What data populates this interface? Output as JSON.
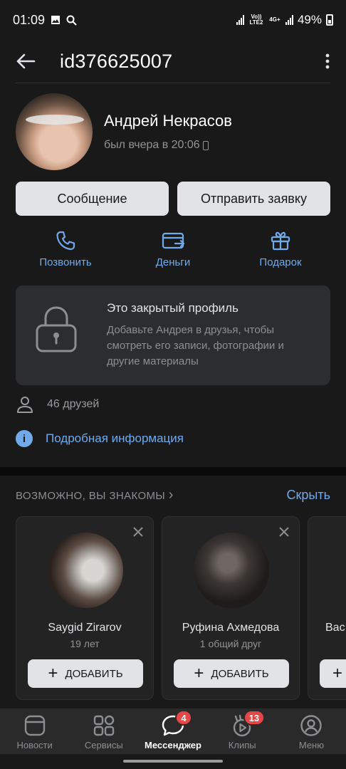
{
  "status_bar": {
    "time": "01:09",
    "network_label": "Vo)) LTE2",
    "network_type": "4G+",
    "battery": "49%",
    "icons": [
      "image-icon",
      "search-icon",
      "signal-icon",
      "battery-icon"
    ]
  },
  "header": {
    "title": "id376625007",
    "back_icon": "arrow-left-icon",
    "more_icon": "more-vertical-icon"
  },
  "profile": {
    "name": "Андрей Некрасов",
    "last_seen": "был вчера в 20:06"
  },
  "buttons": {
    "message": "Сообщение",
    "add_friend": "Отправить заявку"
  },
  "actions": [
    {
      "label": "Позвонить",
      "icon": "phone-icon"
    },
    {
      "label": "Деньги",
      "icon": "money-transfer-icon"
    },
    {
      "label": "Подарок",
      "icon": "gift-icon"
    }
  ],
  "closed_profile": {
    "title": "Это закрытый профиль",
    "line1": "Добавьте Андрея в друзья, чтобы",
    "line2": "смотреть его записи, фотографии и",
    "line3": "другие материалы"
  },
  "friends": {
    "text": "46 друзей"
  },
  "details": {
    "text": "Подробная информация"
  },
  "suggestions": {
    "title": "ВОЗМОЖНО, ВЫ ЗНАКОМЫ",
    "chevron": "›",
    "hide": "Скрыть",
    "cards": [
      {
        "name": "Saygid Zirarov",
        "sub": "19 лет",
        "button": "ДОБАВИТЬ"
      },
      {
        "name": "Руфина Ахмедова",
        "sub": "1 общий друг",
        "button": "ДОБАВИТЬ"
      },
      {
        "name": "Вас",
        "sub": "",
        "button": ""
      }
    ]
  },
  "tabbar": {
    "items": [
      {
        "label": "Новости",
        "icon": "news-icon"
      },
      {
        "label": "Сервисы",
        "icon": "services-icon"
      },
      {
        "label": "Мессенджер",
        "icon": "messenger-icon",
        "badge": "4",
        "active": true
      },
      {
        "label": "Клипы",
        "icon": "clips-icon",
        "badge": "13"
      },
      {
        "label": "Меню",
        "icon": "menu-profile-icon"
      }
    ]
  },
  "colors": {
    "background": "#19191a",
    "accent": "#71aaeb",
    "badge": "#e64646",
    "button": "#e1e3e6"
  }
}
